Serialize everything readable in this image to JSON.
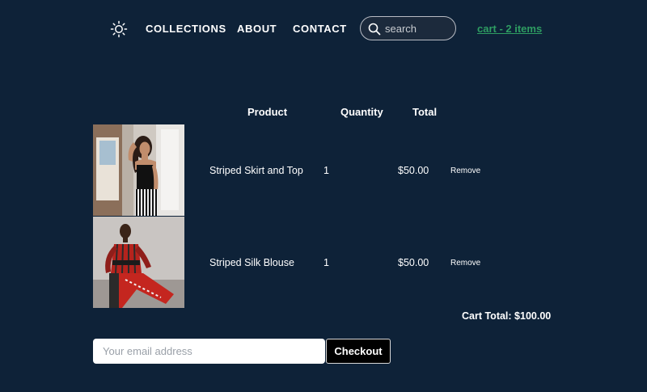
{
  "nav": {
    "theme_icon": "sun-icon",
    "links": [
      {
        "label": "COLLECTIONS"
      },
      {
        "label": "ABOUT"
      },
      {
        "label": "CONTACT"
      }
    ],
    "search": {
      "placeholder": "search",
      "value": "",
      "icon": "search-icon"
    },
    "cart_link": "cart - 2 items",
    "cart_link_color": "#2e9d62"
  },
  "cart": {
    "headers": {
      "product": "Product",
      "quantity": "Quantity",
      "total": "Total"
    },
    "items": [
      {
        "image": "product-photo-woman-black-top-striped-skirt",
        "name": "Striped Skirt and Top",
        "quantity": "1",
        "total": "$50.00",
        "remove_label": "Remove"
      },
      {
        "image": "product-photo-red-striped-silk-blouse",
        "name": "Striped Silk Blouse",
        "quantity": "1",
        "total": "$50.00",
        "remove_label": "Remove"
      }
    ],
    "cart_total": "Cart Total: $100.00"
  },
  "checkout": {
    "email_placeholder": "Your email address",
    "email_value": "",
    "button_label": "Checkout"
  },
  "colors": {
    "background": "#0e2238",
    "text": "#ffffff",
    "accent": "#2e9d62",
    "checkout_button": "#000000"
  }
}
